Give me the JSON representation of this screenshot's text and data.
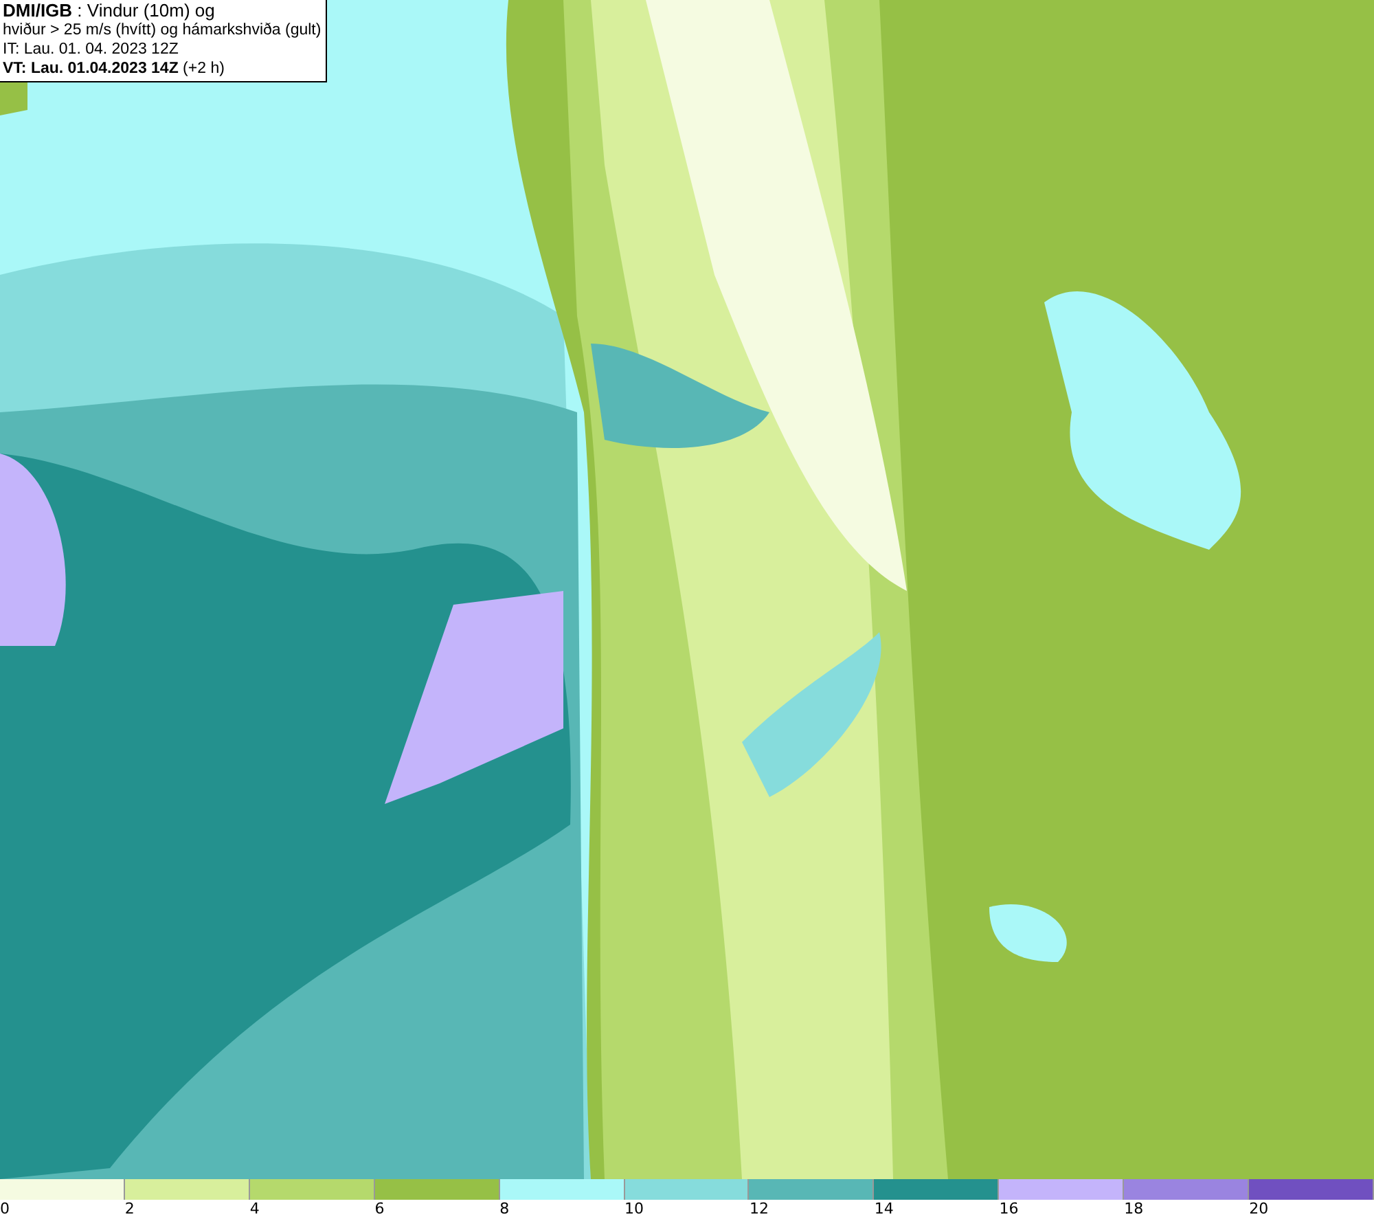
{
  "header": {
    "lines": [
      "**DMI/IGB** : Vindur (10m) og",
      "hviður > 25 m/s (hvítt) og hámarkshviða (gult)",
      "IT: Lau. 01. 04. 2023 12Z",
      "**VT: Lau. 01.04.2023 14Z** (+2 h)"
    ]
  },
  "legend": {
    "bins": [
      {
        "color": "#f5fbe1"
      },
      {
        "color": "#d8ef9c"
      },
      {
        "color": "#b5d96c"
      },
      {
        "color": "#96c046"
      },
      {
        "color": "#aaf8f8"
      },
      {
        "color": "#86dcdc"
      },
      {
        "color": "#58b7b5"
      },
      {
        "color": "#24918e"
      },
      {
        "color": "#c4b4fb"
      },
      {
        "color": "#9a84e0"
      },
      {
        "color": "#7050c0"
      }
    ],
    "labels": [
      "0",
      "2",
      "4",
      "6",
      "8",
      "10",
      "12",
      "14",
      "16",
      "18",
      "20"
    ]
  }
}
